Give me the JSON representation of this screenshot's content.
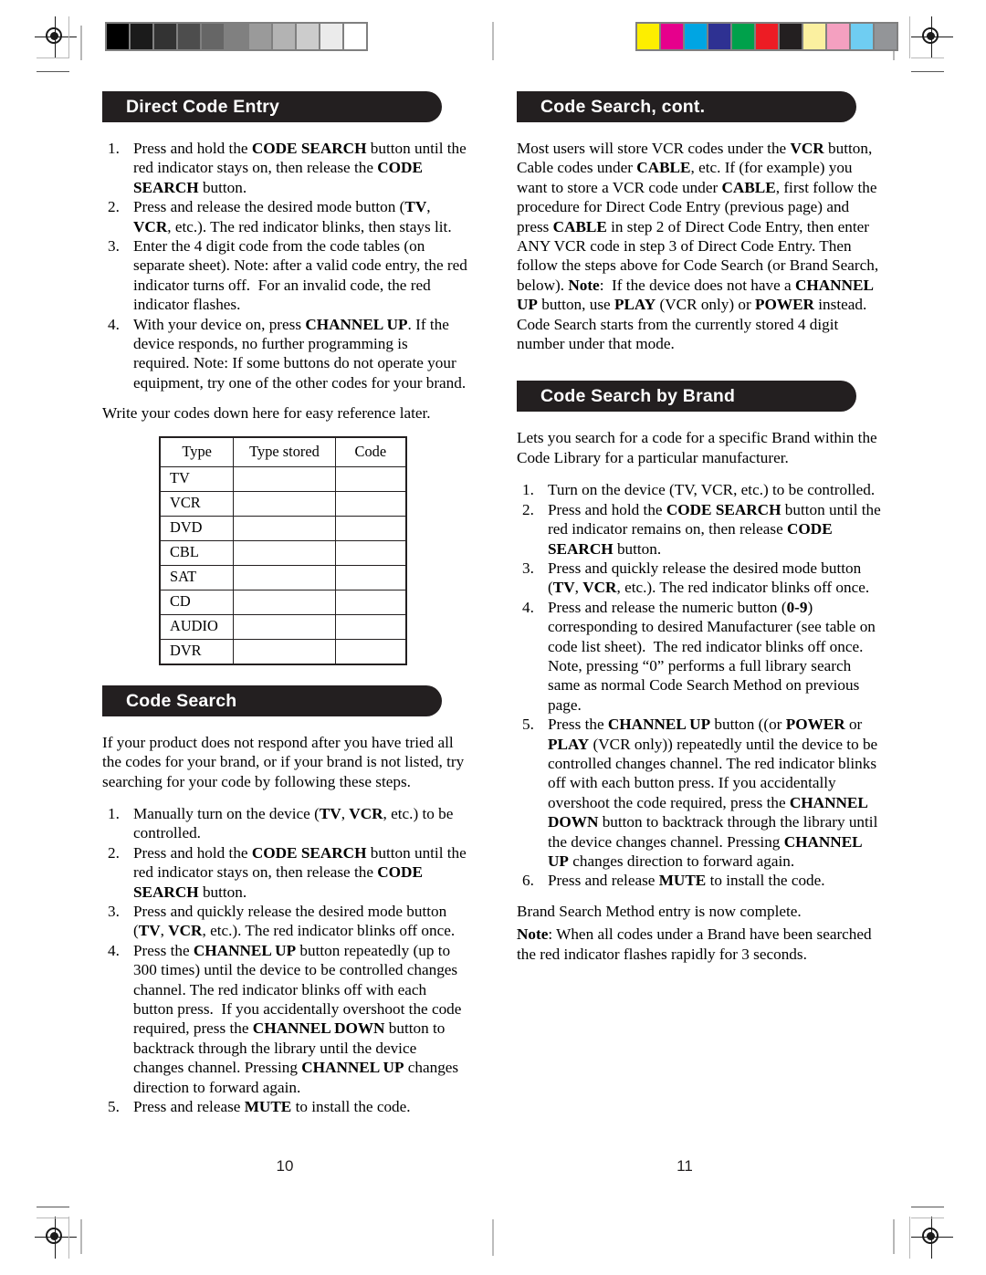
{
  "document": {
    "kind": "printed-manual-spread",
    "left_page_number": "10",
    "right_page_number": "11"
  },
  "calibration": {
    "grayscale_bar": {
      "name": "grayscale-step-wedge",
      "swatches": [
        "#000000",
        "#1b1b1b",
        "#333333",
        "#4d4d4d",
        "#666666",
        "#808080",
        "#9a9a9a",
        "#b3b3b3",
        "#cccccc",
        "#ebebeb",
        "#ffffff"
      ]
    },
    "color_bar": {
      "name": "process-color-bar",
      "swatches": [
        "#fdee00",
        "#e6008c",
        "#00a5e3",
        "#2e3192",
        "#00a14b",
        "#ed1c24",
        "#231f20",
        "#fbf0a0",
        "#f4a0c0",
        "#6fcdf2",
        "#939598"
      ]
    }
  },
  "left_page": {
    "sections": [
      {
        "header": "Direct Code Entry",
        "steps": [
          "Press and hold the <b>CODE SEARCH</b> button until the red indicator stays on, then release the <b>CODE SEARCH</b> button.",
          "Press and release the desired mode button (<b>TV</b>, <b>VCR</b>, etc.). The red indicator blinks, then stays lit.",
          "Enter the 4 digit code from the code tables (on separate sheet). Note: after a valid code entry, the red indicator turns off.&nbsp; For an invalid code, the red indicator flashes.",
          "With your device on, press <b>CHANNEL UP</b>. If the device responds, no further programming is required. Note: If some buttons do not operate your equipment, try one of the other codes for your brand."
        ],
        "closing": "Write your codes down here for easy reference later."
      },
      {
        "header": "Code Search",
        "intro": "If your product does not respond after you have tried all the codes for your brand, or if your brand is not listed, try searching for your code by following these steps.",
        "steps": [
          "Manually turn on the device (<b>TV</b>, <b>VCR</b>, etc.) to be controlled.",
          "Press and hold the <b>CODE SEARCH</b> button until the red indicator stays on, then release the <b>CODE SEARCH</b> button.",
          "Press and quickly release the desired mode button (<b>TV</b>, <b>VCR</b>, etc.). The red indicator blinks off once.",
          "Press the <b>CHANNEL UP</b> button repeatedly (up to 300 times) until the device to be controlled changes channel. The red indicator blinks off with each button press.&nbsp; If you accidentally overshoot the code required, press the <b>CHANNEL DOWN</b> button to backtrack through the library until the device changes channel. Pressing <b>CHANNEL UP</b> changes direction to forward again.",
          "Press and release <b>MUTE</b> to install the code."
        ]
      }
    ],
    "code_table": {
      "columns": [
        "Type",
        "Type stored",
        "Code"
      ],
      "rows": [
        {
          "type": "TV",
          "stored": "",
          "code": ""
        },
        {
          "type": "VCR",
          "stored": "",
          "code": ""
        },
        {
          "type": "DVD",
          "stored": "",
          "code": ""
        },
        {
          "type": "CBL",
          "stored": "",
          "code": ""
        },
        {
          "type": "SAT",
          "stored": "",
          "code": ""
        },
        {
          "type": "CD",
          "stored": "",
          "code": ""
        },
        {
          "type": "AUDIO",
          "stored": "",
          "code": ""
        },
        {
          "type": "DVR",
          "stored": "",
          "code": ""
        }
      ]
    }
  },
  "right_page": {
    "sections": [
      {
        "header": "Code Search, cont.",
        "body": "Most users will store VCR codes under the <b>VCR</b> button, Cable codes under <b>CABLE</b>, etc. If (for example) you want to store a VCR code under <b>CABLE</b>, first follow the procedure for Direct Code Entry (previous page) and press <b>CABLE</b> in step 2 of Direct Code Entry, then enter ANY VCR code in step 3 of Direct Code Entry. Then follow the steps above for Code Search (or Brand Search, below). <b>Note</b>:&nbsp; If the device does not have a <b>CHANNEL UP</b> button, use <b>PLAY</b> (VCR only) or <b>POWER</b> instead. Code Search starts from the currently stored 4 digit number under that mode."
      },
      {
        "header": "Code Search by Brand",
        "intro": "Lets you search for a code for a specific Brand within the Code Library for a particular manufacturer.",
        "steps": [
          "Turn on the device (TV, VCR, etc.) to be controlled.",
          "Press and hold the <b>CODE SEARCH</b> button until the red indicator remains on, then release <b>CODE SEARCH</b> button.",
          "Press and quickly release the desired mode button (<b>TV</b>, <b>VCR</b>, etc.). The red indicator blinks off once.",
          "Press and release the numeric button (<b>0-9</b>) corresponding to desired Manufacturer (see table on code list sheet).&nbsp; The red indicator blinks off once. Note, pressing &ldquo;0&rdquo; performs a full library search same as normal Code Search Method on previous page.",
          "Press the <b>CHANNEL UP</b> button ((or <b>POWER</b> or <b>PLAY</b> (VCR only)) repeatedly until the device to be controlled changes channel. The red indicator blinks off with each button press. If you accidentally overshoot the code required, press the <b>CHANNEL DOWN</b> button to backtrack through the library until the device changes channel. Pressing <b>CHANNEL UP</b> changes direction to forward again.",
          "Press and release <b>MUTE</b> to install the code."
        ],
        "closing_line_1": "Brand Search Method entry is now complete.",
        "closing_line_2": "<b>Note</b>: When all codes under a Brand have been searched the red indicator flashes rapidly for 3 seconds."
      }
    ]
  }
}
